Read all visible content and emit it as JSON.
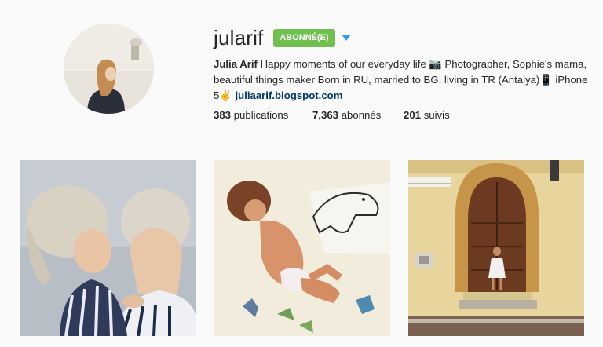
{
  "profile": {
    "username": "jularif",
    "follow_button": "ABONNÉ(E)",
    "full_name": "Julia Arif",
    "bio_text": "Happy moments of our everyday life 📷 Photographer, Sophie's mama, beautiful things maker Born in RU, married to BG, living in TR (Antalya)📱 iPhone 5✌️",
    "website": "juliaarif.blogspot.com"
  },
  "stats": {
    "posts_count": "383",
    "posts_label": "publications",
    "followers_count": "7,363",
    "followers_label": "abonnés",
    "following_count": "201",
    "following_label": "suivis"
  },
  "colors": {
    "follow_green": "#70c050",
    "link_blue": "#003569",
    "caret_blue": "#3897f0"
  },
  "icons": {
    "dropdown": "chevron-down-icon"
  }
}
